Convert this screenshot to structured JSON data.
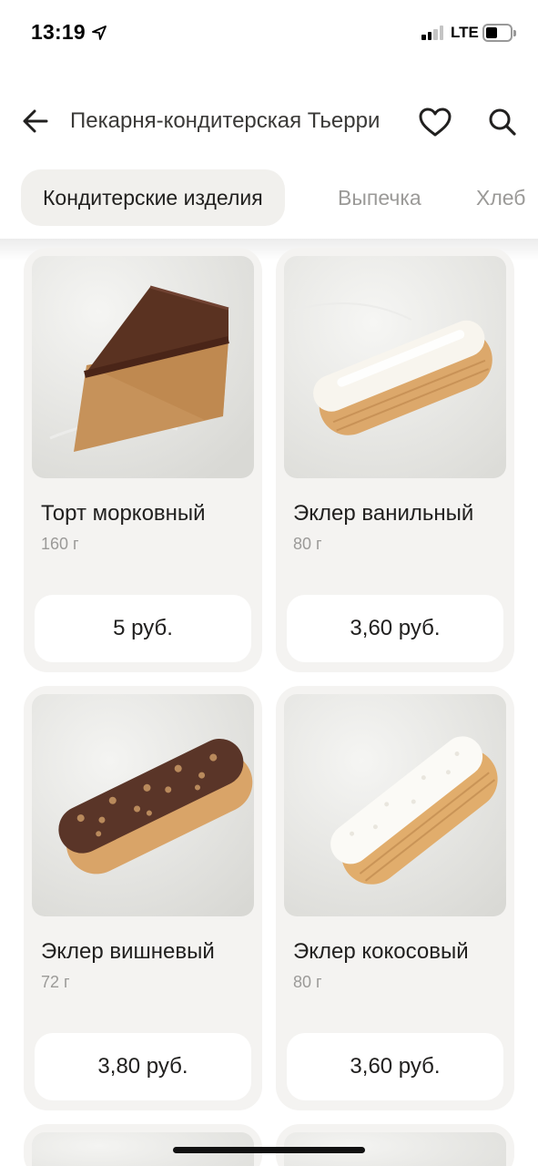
{
  "status_bar": {
    "time": "13:19",
    "network": "LTE"
  },
  "header": {
    "title": "Пекарня-кондитерская Тьерри"
  },
  "tabs": [
    {
      "label": "Кондитерские изделия",
      "active": true
    },
    {
      "label": "Выпечка",
      "active": false
    },
    {
      "label": "Хлеб",
      "active": false
    }
  ],
  "products": [
    {
      "name": "Торт морковный",
      "weight": "160 г",
      "price": "5 руб."
    },
    {
      "name": "Эклер ванильный",
      "weight": "80 г",
      "price": "3,60 руб."
    },
    {
      "name": "Эклер вишневый",
      "weight": "72 г",
      "price": "3,80 руб."
    },
    {
      "name": "Эклер кокосовый",
      "weight": "80 г",
      "price": "3,60 руб."
    }
  ],
  "colors": {
    "accent": "#f1f0ed",
    "card_bg": "#f4f3f1",
    "text": "#21201f",
    "muted": "#9b9a98"
  }
}
